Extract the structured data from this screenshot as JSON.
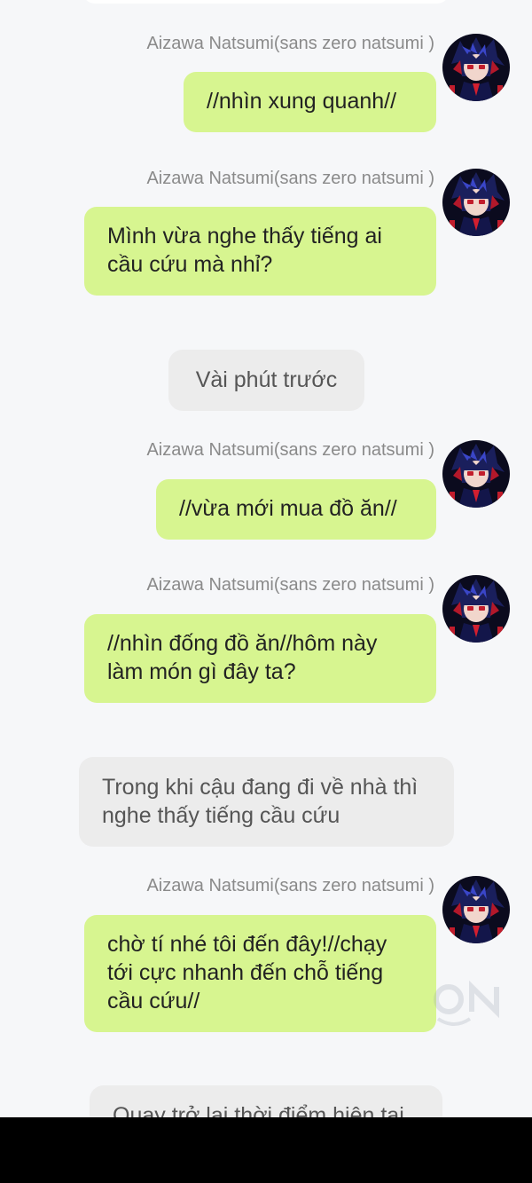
{
  "messages": [
    {
      "sender": "Aizawa Natsumi(sans zero natsumi )",
      "text": "//nhìn xung quanh//"
    },
    {
      "sender": "Aizawa Natsumi(sans zero natsumi )",
      "text": "Mình vừa nghe thấy tiếng ai cầu cứu mà nhỉ?"
    },
    {
      "narration": "Vài phút trước"
    },
    {
      "sender": "Aizawa Natsumi(sans zero natsumi )",
      "text": "//vừa mới mua đồ ăn//"
    },
    {
      "sender": "Aizawa Natsumi(sans zero natsumi )",
      "text": "//nhìn đống đồ ăn//hôm này làm món gì đây ta?"
    },
    {
      "narration": "Trong khi cậu đang đi về nhà thì nghe thấy tiếng cầu cứu"
    },
    {
      "sender": "Aizawa Natsumi(sans zero natsumi )",
      "text": "chờ tí nhé tôi đến đây!//chạy tới cực nhanh đến chỗ tiếng cầu cứu//"
    },
    {
      "narration": "Quay trở lại thời điểm hiện tại"
    }
  ],
  "colors": {
    "background": "#f6f7f9",
    "user_bubble": "#d7f590",
    "narration_bubble": "#ececec"
  }
}
